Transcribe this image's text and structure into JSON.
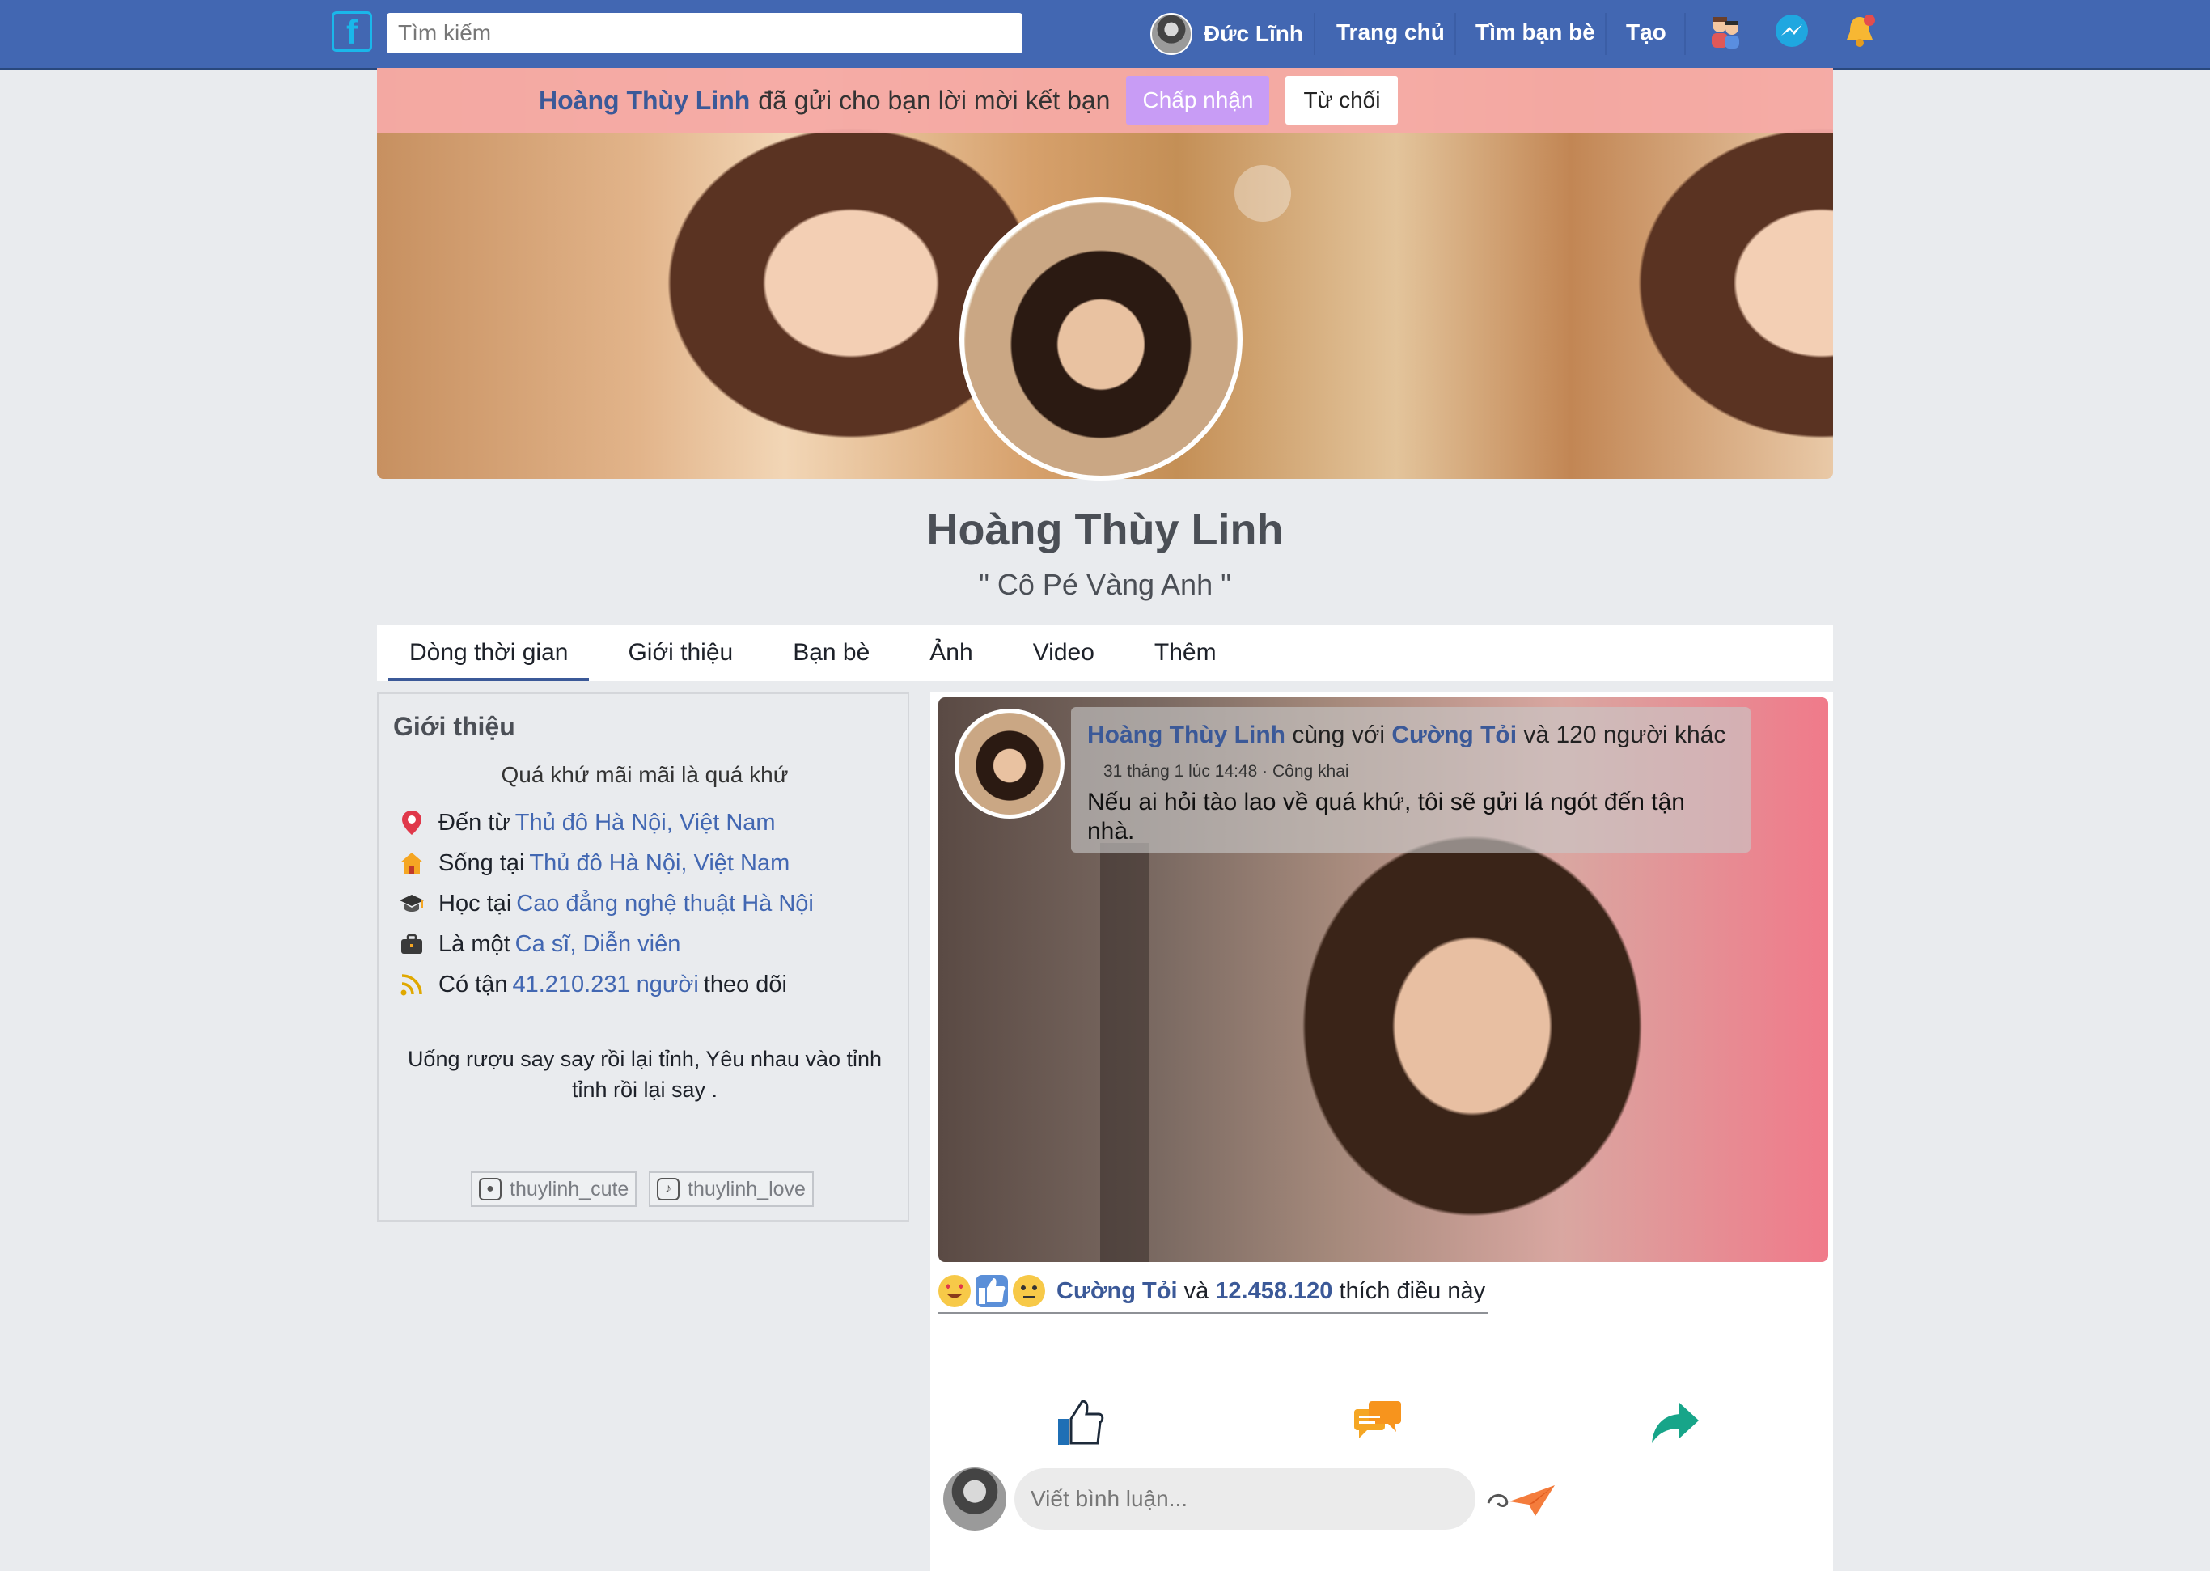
{
  "topbar": {
    "logo": "f",
    "search_placeholder": "Tìm kiếm",
    "user_name": "Đức Lĩnh",
    "nav": [
      "Trang chủ",
      "Tìm bạn bè",
      "Tạo"
    ],
    "icons": [
      "friends-icon",
      "messenger-icon",
      "notifications-icon"
    ],
    "bg_color": "#4267b2"
  },
  "friend_request": {
    "name": "Hoàng Thùy Linh",
    "text": "đã gửi cho bạn lời mời kết bạn",
    "accept": "Chấp nhận",
    "decline": "Từ chối"
  },
  "profile": {
    "name": "Hoàng Thùy Linh",
    "quote": "\" Cô Pé Vàng Anh \""
  },
  "tabs": [
    "Dòng thời gian",
    "Giới thiệu",
    "Bạn bè",
    "Ảnh",
    "Video",
    "Thêm"
  ],
  "intro": {
    "title": "Giới thiệu",
    "bio": "Quá khứ mãi mãi là quá khứ",
    "rows": [
      {
        "icon": "location-pin-icon",
        "prefix": "Đến từ",
        "link": "Thủ đô Hà Nội, Việt Nam",
        "suffix": ""
      },
      {
        "icon": "home-icon",
        "prefix": "Sống tại",
        "link": "Thủ đô Hà Nội, Việt Nam",
        "suffix": ""
      },
      {
        "icon": "graduation-cap-icon",
        "prefix": "Học tại",
        "link": "Cao đẳng nghệ thuật Hà Nội",
        "suffix": ""
      },
      {
        "icon": "briefcase-icon",
        "prefix": "Là một",
        "link": "Ca sĩ, Diễn viên",
        "suffix": ""
      },
      {
        "icon": "rss-icon",
        "prefix": "Có tận",
        "link": "41.210.231 người",
        "suffix": "theo dõi"
      }
    ],
    "quote_line1": "Uống rượu say say rồi lại tỉnh, Yêu nhau vào tỉnh",
    "quote_line2": "tỉnh rồi lại say .",
    "instagram": "thuylinh_cute",
    "tiktok": "thuylinh_love"
  },
  "post": {
    "author": "Hoàng Thùy Linh",
    "with_word": "cùng với",
    "tagged": "Cường Tỏi",
    "others": "và 120 người khác",
    "meta": "31 tháng 1 lúc 14:48 · Công khai",
    "text": "Nếu ai hỏi tào lao về quá khứ, tôi sẽ gửi lá ngót đến tận nhà.",
    "reactions": {
      "name": "Cường Tỏi",
      "and": "và",
      "count": "12.458.120",
      "suffix": "thích điều này"
    },
    "comment_placeholder": "Viết bình luận..."
  }
}
